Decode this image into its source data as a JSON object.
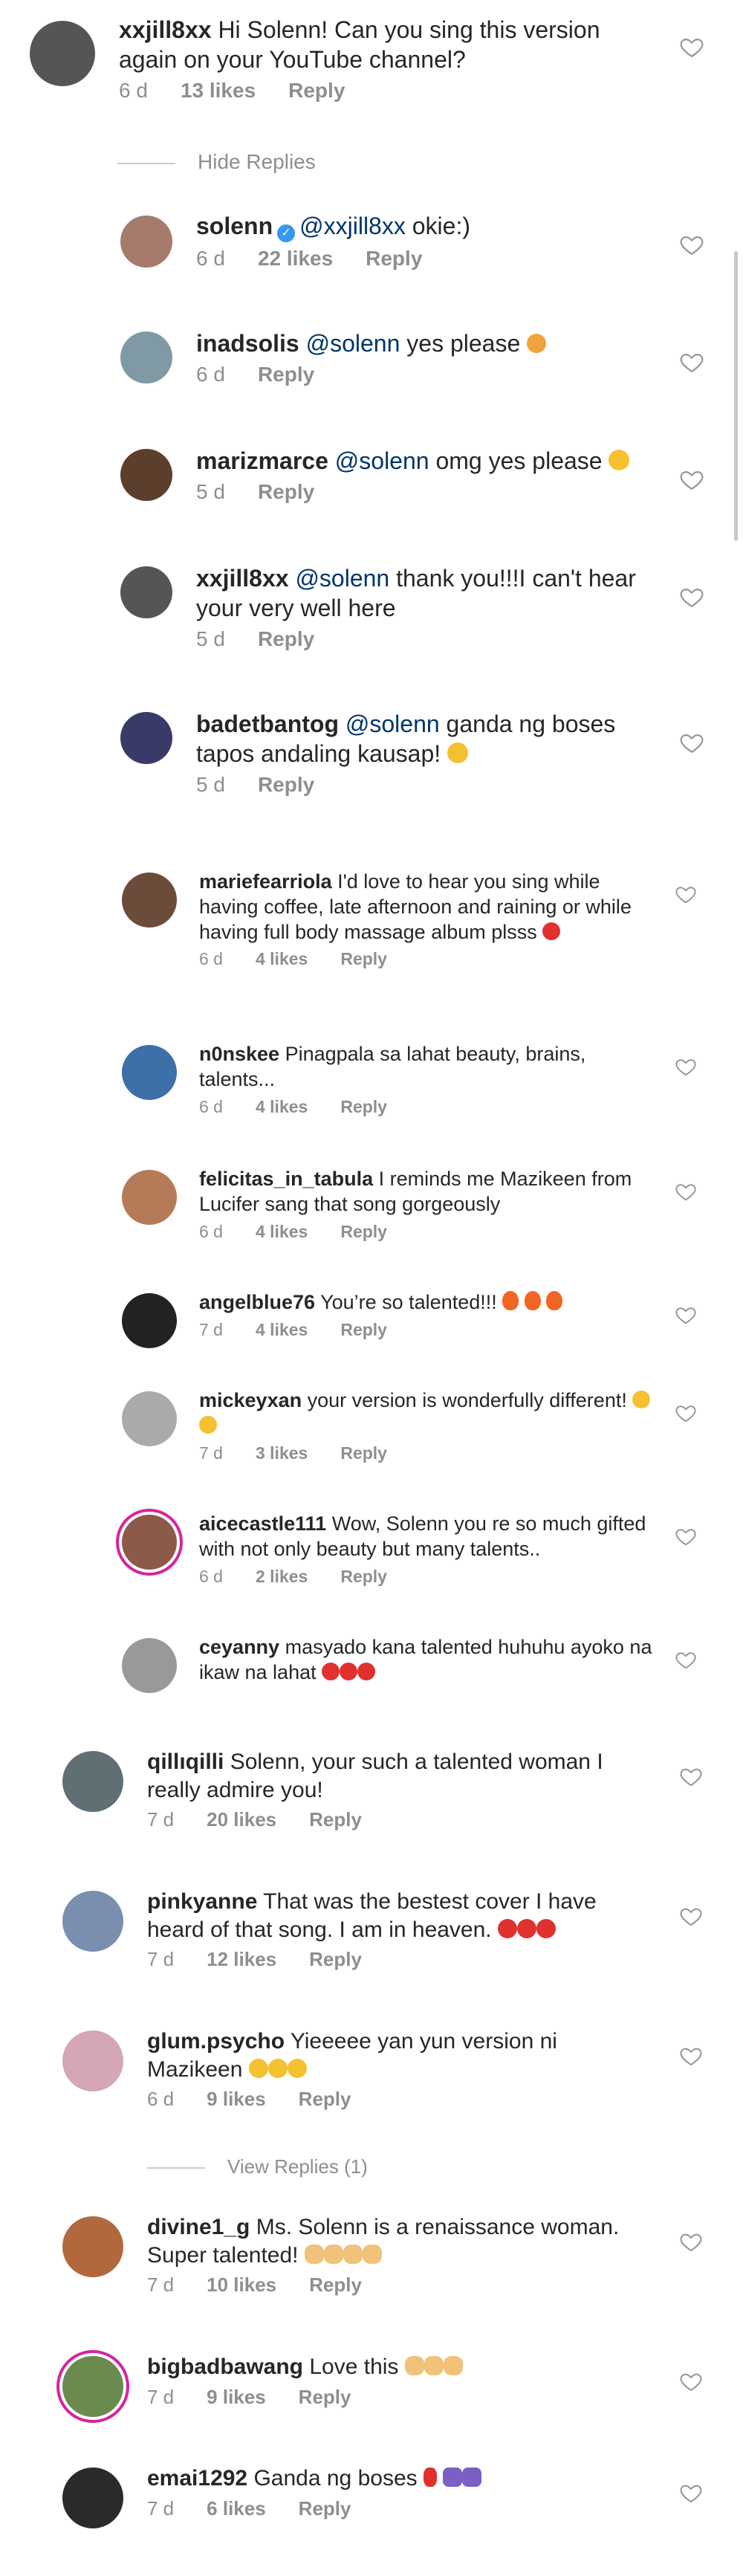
{
  "reply_toggles": {
    "hide": "Hide Replies",
    "view": "View Replies (1)"
  },
  "action": {
    "reply": "Reply"
  },
  "comments": [
    {
      "user": "xxjill8xx",
      "text": "Hi Solenn! Can you sing this version again on your YouTube channel?",
      "time": "6 d",
      "likes": "13 likes"
    },
    {
      "user": "solenn",
      "mention": "@xxjill8xx",
      "text": "okie:)",
      "time": "6 d",
      "likes": "22 likes"
    },
    {
      "user": "inadsolis",
      "mention": "@solenn",
      "text": "yes please",
      "time": "6 d",
      "likes": ""
    },
    {
      "user": "marizmarce",
      "mention": "@solenn",
      "text": "omg yes please",
      "time": "5 d",
      "likes": ""
    },
    {
      "user": "xxjill8xx",
      "mention": "@solenn",
      "text": "thank you!!!I can't hear your very well here",
      "time": "5 d",
      "likes": ""
    },
    {
      "user": "badetbantog",
      "mention": "@solenn",
      "text": "ganda ng boses tapos andaling kausap!",
      "time": "5 d",
      "likes": ""
    },
    {
      "user": "mariefearriola",
      "text": "I'd love to hear you sing while having coffee, late afternoon and raining or while having full body massage album plsss",
      "time": "6 d",
      "likes": "4 likes"
    },
    {
      "user": "n0nskee",
      "text": "Pinagpala sa lahat beauty, brains, talents...",
      "time": "6 d",
      "likes": "4 likes"
    },
    {
      "user": "felicitas_in_tabula",
      "text": "I reminds me Mazikeen from Lucifer sang that song gorgeously",
      "time": "6 d",
      "likes": "4 likes"
    },
    {
      "user": "angelblue76",
      "text": "You’re so talented!!!",
      "time": "7 d",
      "likes": "4 likes"
    },
    {
      "user": "mickeyxan",
      "text": "your version is wonderfully different!",
      "time": "7 d",
      "likes": "3 likes"
    },
    {
      "user": "aicecastle111",
      "text": "Wow, Solenn you re so much gifted with not only beauty but many talents..",
      "time": "6 d",
      "likes": "2 likes"
    },
    {
      "user": "ceyanny",
      "text": "masyado kana talented huhuhu ayoko na ikaw na lahat",
      "time": "",
      "likes": ""
    },
    {
      "user": "qillıqilli",
      "text": "Solenn, your such a talented woman I really admire you!",
      "time": "7 d",
      "likes": "20 likes"
    },
    {
      "user": "pinkyanne",
      "text": "That was the bestest cover I have heard of that song. I am in heaven.",
      "time": "7 d",
      "likes": "12 likes"
    },
    {
      "user": "glum.psycho",
      "text": "Yieeeee yan yun version ni Mazikeen",
      "time": "6 d",
      "likes": "9 likes"
    },
    {
      "user": "divine1_g",
      "text": "Ms. Solenn is a renaissance woman. Super talented!",
      "time": "7 d",
      "likes": "10 likes"
    },
    {
      "user": "bigbadbawang",
      "text": "Love this",
      "time": "7 d",
      "likes": "9 likes"
    },
    {
      "user": "emai1292",
      "text": "Ganda ng boses",
      "time": "7 d",
      "likes": "6 likes"
    }
  ],
  "icons": {
    "heart": "heart-outline-icon",
    "verified": "verified-badge-icon"
  },
  "colors": {
    "username": "#262626",
    "mention": "#003569",
    "meta": "#8e8e8e",
    "avatar_ring": "#d6249f"
  }
}
